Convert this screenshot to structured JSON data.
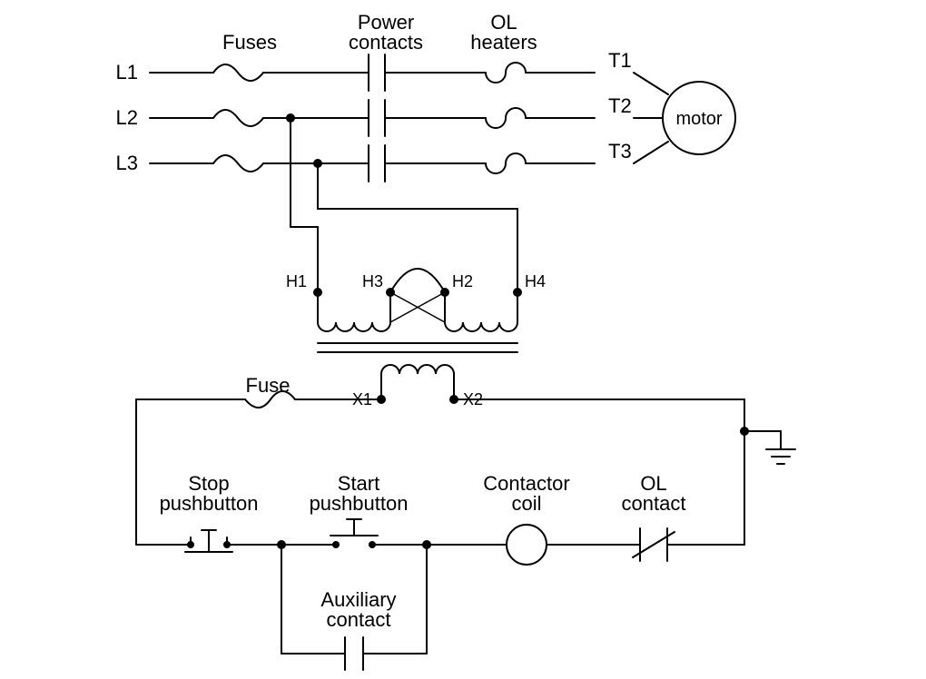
{
  "labels": {
    "fuses": "Fuses",
    "power_contacts_l1": "Power",
    "power_contacts_l2": "contacts",
    "ol_heaters_l1": "OL",
    "ol_heaters_l2": "heaters",
    "L1": "L1",
    "L2": "L2",
    "L3": "L3",
    "T1": "T1",
    "T2": "T2",
    "T3": "T3",
    "motor": "motor",
    "H1": "H1",
    "H2": "H2",
    "H3": "H3",
    "H4": "H4",
    "X1": "X1",
    "X2": "X2",
    "fuse": "Fuse",
    "stop_l1": "Stop",
    "stop_l2": "pushbutton",
    "start_l1": "Start",
    "start_l2": "pushbutton",
    "contactor_l1": "Contactor",
    "contactor_l2": "coil",
    "ol_contact_l1": "OL",
    "ol_contact_l2": "contact",
    "aux_l1": "Auxiliary",
    "aux_l2": "contact"
  }
}
